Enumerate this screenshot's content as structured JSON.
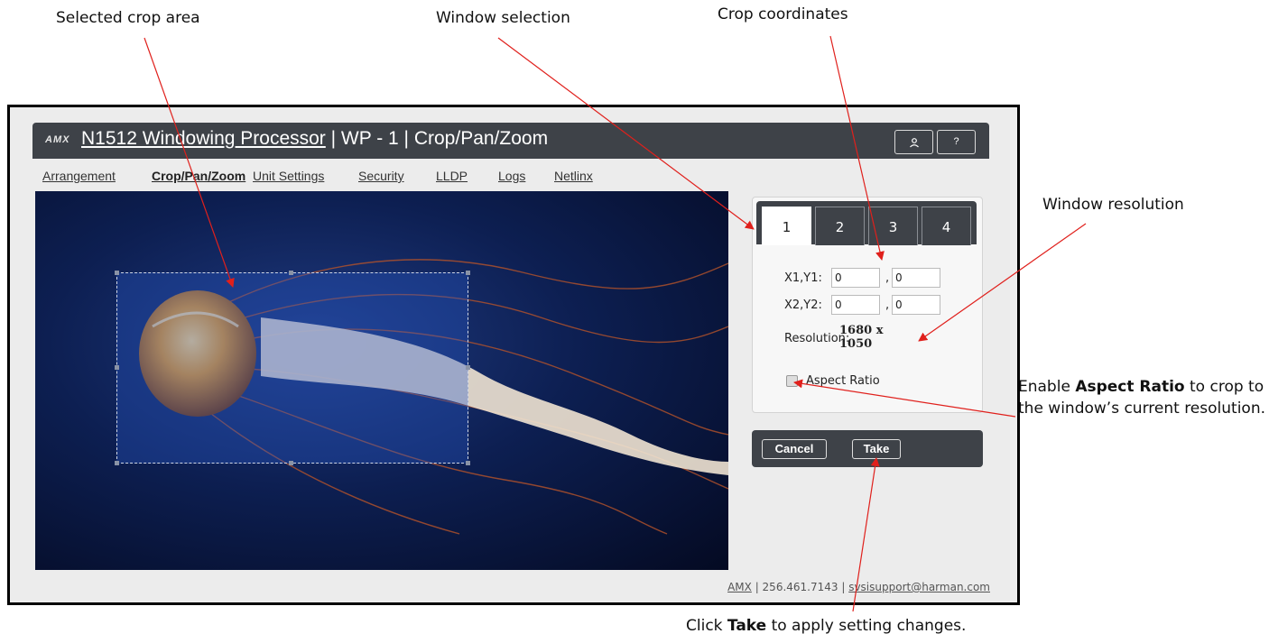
{
  "callouts": {
    "selected_crop_area": "Selected crop area",
    "window_selection": "Window selection",
    "crop_coordinates": "Crop coordinates",
    "window_resolution": "Window resolution",
    "aspect_pre": "Enable ",
    "aspect_bold": "Aspect Ratio",
    "aspect_post": " to crop to the window’s current resolution.",
    "take_pre": "Click ",
    "take_bold": "Take",
    "take_post": " to apply setting changes."
  },
  "header": {
    "logo": "AMX",
    "device_name": "N1512 Windowing Processor",
    "separator": " | ",
    "unit": "WP - 1",
    "separator2": " | ",
    "page": "Crop/Pan/Zoom",
    "user_icon": "person-icon",
    "help_label": "?"
  },
  "nav": [
    {
      "label": "Arrangement",
      "active": false
    },
    {
      "label": "Crop/Pan/Zoom",
      "active": true
    },
    {
      "label": "Unit Settings",
      "active": false
    },
    {
      "label": "Security",
      "active": false
    },
    {
      "label": "LLDP",
      "active": false
    },
    {
      "label": "Logs",
      "active": false
    },
    {
      "label": "Netlinx",
      "active": false
    }
  ],
  "tabs": [
    {
      "label": "1",
      "active": true
    },
    {
      "label": "2",
      "active": false
    },
    {
      "label": "3",
      "active": false
    },
    {
      "label": "4",
      "active": false
    }
  ],
  "crop": {
    "x1y1_label": "X1,Y1:",
    "x2y2_label": "X2,Y2:",
    "x1": "0",
    "y1": "0",
    "x2": "0",
    "y2": "0",
    "comma": ","
  },
  "resolution": {
    "label": "Resolution:",
    "line1": "1680 x",
    "line2": "1050"
  },
  "aspect_ratio": {
    "label": "Aspect Ratio",
    "checked": false
  },
  "actions": {
    "cancel": "Cancel",
    "take": "Take"
  },
  "footer": {
    "brand": "AMX",
    "phone": " | 256.461.7143 | ",
    "email": "svsisupport@harman.com"
  },
  "colors": {
    "header_bg": "#3e4248",
    "annotation": "#e0201c"
  }
}
